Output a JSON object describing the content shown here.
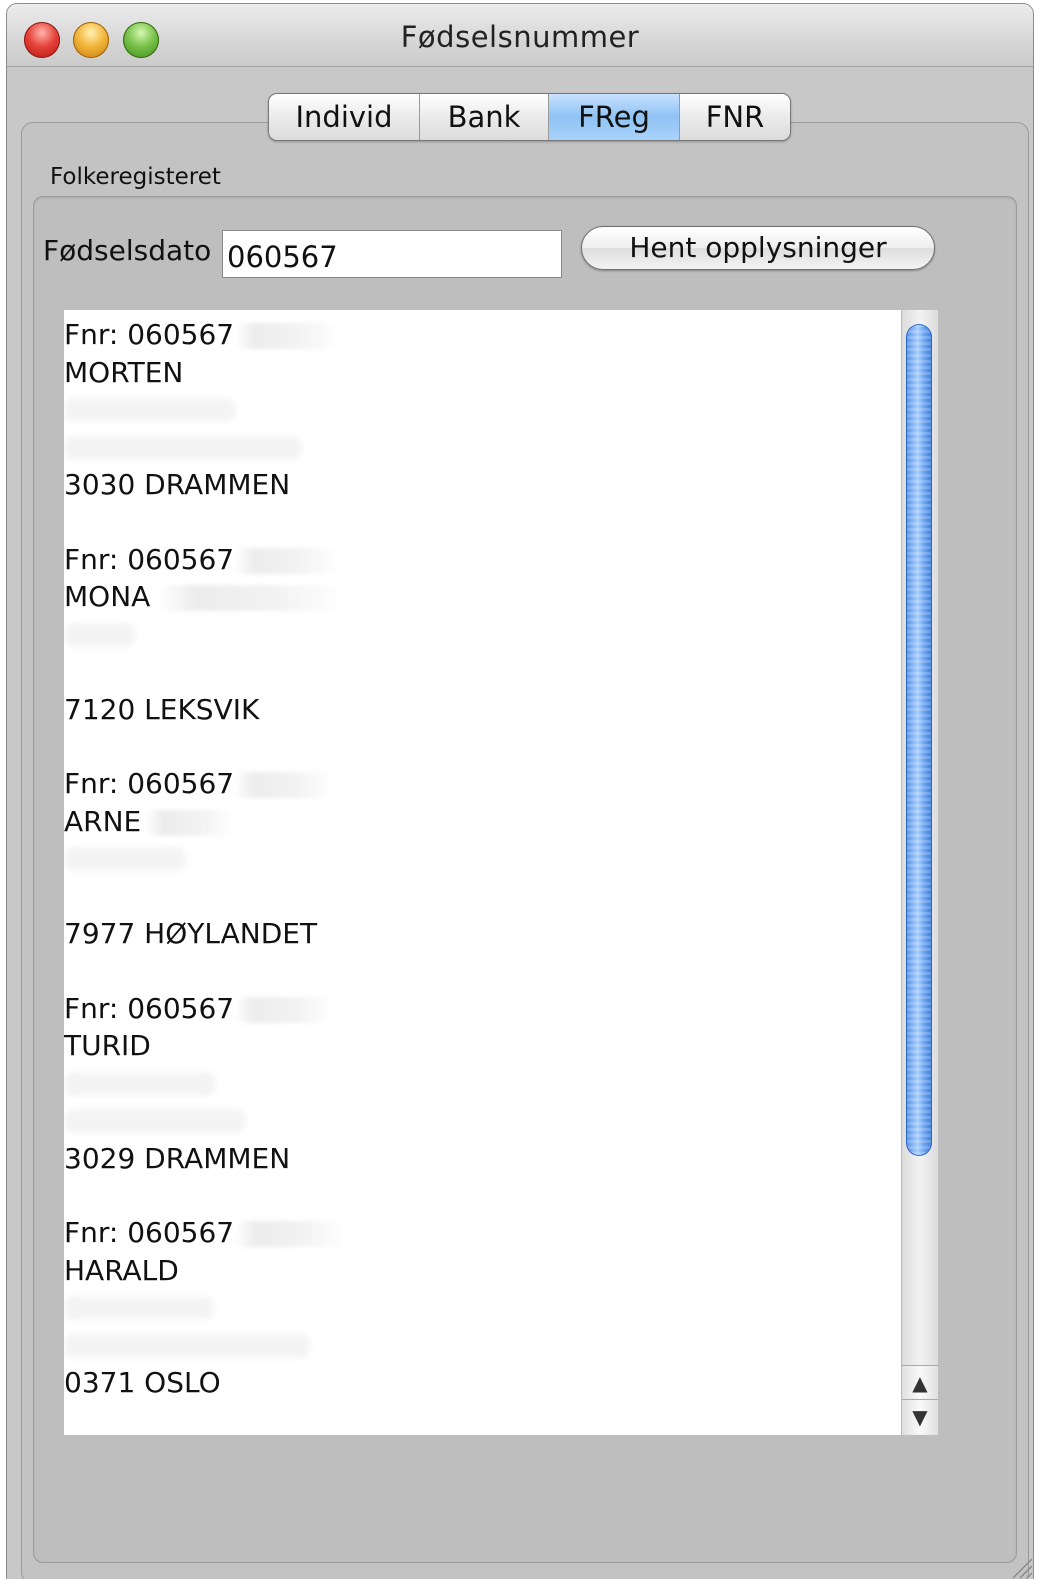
{
  "window": {
    "title": "Fødselsnummer"
  },
  "tabs": [
    {
      "label": "Individ",
      "selected": false
    },
    {
      "label": "Bank",
      "selected": false
    },
    {
      "label": "FReg",
      "selected": true
    },
    {
      "label": "FNR",
      "selected": false
    }
  ],
  "group": {
    "label": "Folkeregisteret"
  },
  "form": {
    "date_label": "Fødselsdato",
    "date_value": "060567",
    "fetch_button": "Hent opplysninger"
  },
  "results": [
    {
      "fnr": "Fnr: 060567",
      "name": "MORTEN",
      "postal": "3030 DRAMMEN"
    },
    {
      "fnr": "Fnr: 060567",
      "name": "MONA",
      "postal": "7120 LEKSVIK"
    },
    {
      "fnr": "Fnr: 060567",
      "name": "ARNE",
      "postal": "7977 HØYLANDET"
    },
    {
      "fnr": "Fnr: 060567",
      "name": "TURID",
      "postal": "3029 DRAMMEN"
    },
    {
      "fnr": "Fnr: 060567",
      "name": "HARALD",
      "postal": "0371 OSLO"
    }
  ],
  "colors": {
    "selected_tab": "#8fc2f4",
    "scroll_thumb": "#4f8ee8",
    "window_bg": "#c8c8c8"
  },
  "icons": {
    "close": "close-icon",
    "minimize": "minimize-icon",
    "zoom": "zoom-icon",
    "scroll_up": "scroll-up-arrow-icon",
    "scroll_down": "scroll-down-arrow-icon",
    "resize": "resize-grip-icon"
  }
}
